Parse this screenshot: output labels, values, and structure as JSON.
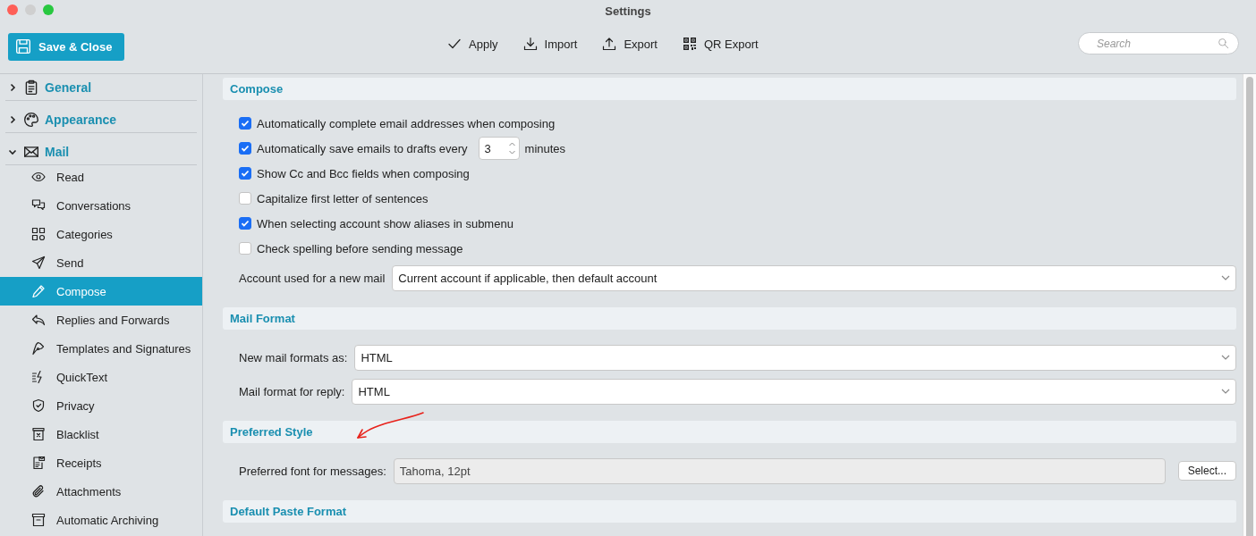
{
  "window": {
    "title": "Settings"
  },
  "toolbar": {
    "save_button": "Save & Close",
    "actions": [
      {
        "label": "Apply"
      },
      {
        "label": "Import"
      },
      {
        "label": "Export"
      },
      {
        "label": "QR Export"
      }
    ],
    "search": {
      "placeholder": "Search"
    }
  },
  "sidebar": {
    "groups": [
      {
        "label": "General",
        "expanded": false
      },
      {
        "label": "Appearance",
        "expanded": false
      },
      {
        "label": "Mail",
        "expanded": true,
        "children": [
          {
            "label": "Read",
            "selected": false
          },
          {
            "label": "Conversations",
            "selected": false
          },
          {
            "label": "Categories",
            "selected": false
          },
          {
            "label": "Send",
            "selected": false
          },
          {
            "label": "Compose",
            "selected": true
          },
          {
            "label": "Replies and Forwards",
            "selected": false
          },
          {
            "label": "Templates and Signatures",
            "selected": false
          },
          {
            "label": "QuickText",
            "selected": false
          },
          {
            "label": "Privacy",
            "selected": false
          },
          {
            "label": "Blacklist",
            "selected": false
          },
          {
            "label": "Receipts",
            "selected": false
          },
          {
            "label": "Attachments",
            "selected": false
          },
          {
            "label": "Automatic Archiving",
            "selected": false
          }
        ]
      }
    ]
  },
  "sections": [
    {
      "title": "Compose",
      "rows": [
        {
          "kind": "checkbox",
          "label": "Automatically complete email addresses when composing",
          "checked": true
        },
        {
          "kind": "checkbox",
          "label": "Automatically save emails to drafts every",
          "checked": true,
          "spin_value": "3",
          "suffix": "minutes"
        },
        {
          "kind": "checkbox",
          "label": "Show Cc and Bcc fields when composing",
          "checked": true
        },
        {
          "kind": "checkbox",
          "label": "Capitalize first letter of sentences",
          "checked": false
        },
        {
          "kind": "checkbox",
          "label": "When selecting account show aliases in submenu",
          "checked": true
        },
        {
          "kind": "checkbox",
          "label": "Check spelling before sending message",
          "checked": false
        },
        {
          "kind": "select",
          "label": "Account used for a new mail",
          "value": "Current account if applicable, then default account"
        }
      ]
    },
    {
      "title": "Mail Format",
      "rows": [
        {
          "kind": "select",
          "label": "New mail formats as:",
          "value": "HTML"
        },
        {
          "kind": "select",
          "label": "Mail format for reply:",
          "value": "HTML"
        }
      ]
    },
    {
      "title": "Preferred Style",
      "rows": [
        {
          "kind": "font",
          "label": "Preferred font for messages:",
          "value": "Tahoma, 12pt",
          "button": "Select..."
        }
      ]
    },
    {
      "title": "Default Paste Format"
    }
  ]
}
